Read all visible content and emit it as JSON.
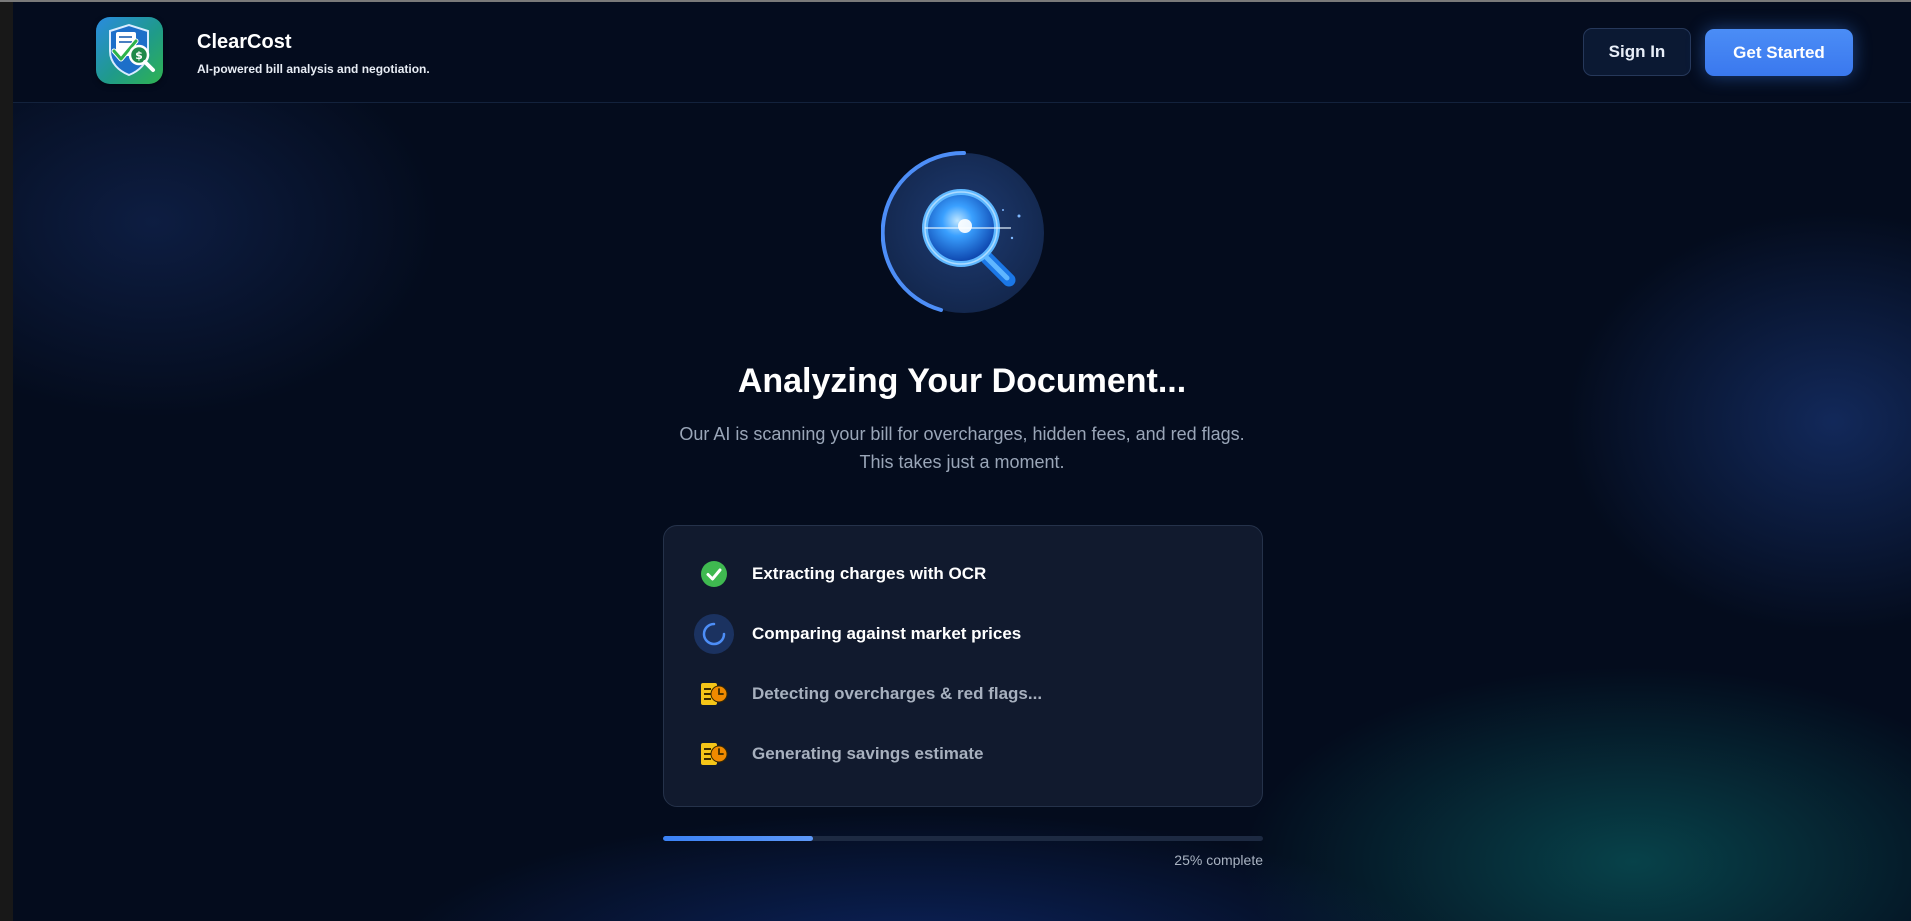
{
  "header": {
    "brand_name": "ClearCost",
    "tagline": "AI-powered bill analysis and negotiation.",
    "sign_in_label": "Sign In",
    "get_started_label": "Get Started"
  },
  "main": {
    "title": "Analyzing Your Document...",
    "subtitle_line1": "Our AI is scanning your bill for overcharges, hidden fees, and red flags.",
    "subtitle_line2": "This takes just a moment."
  },
  "steps": [
    {
      "label": "Extracting charges with OCR",
      "status": "done",
      "icon": "check-circle-icon"
    },
    {
      "label": "Comparing against market prices",
      "status": "active",
      "icon": "spinner-icon"
    },
    {
      "label": "Detecting overcharges & red flags...",
      "status": "pending",
      "icon": "pending-clock-icon"
    },
    {
      "label": "Generating savings estimate",
      "status": "pending",
      "icon": "pending-clock-icon"
    }
  ],
  "progress": {
    "percent": 25,
    "label": "25% complete"
  },
  "colors": {
    "accent": "#3b82f6",
    "background": "#040c1d",
    "success": "#3fb950",
    "pending": "#f5c518"
  }
}
